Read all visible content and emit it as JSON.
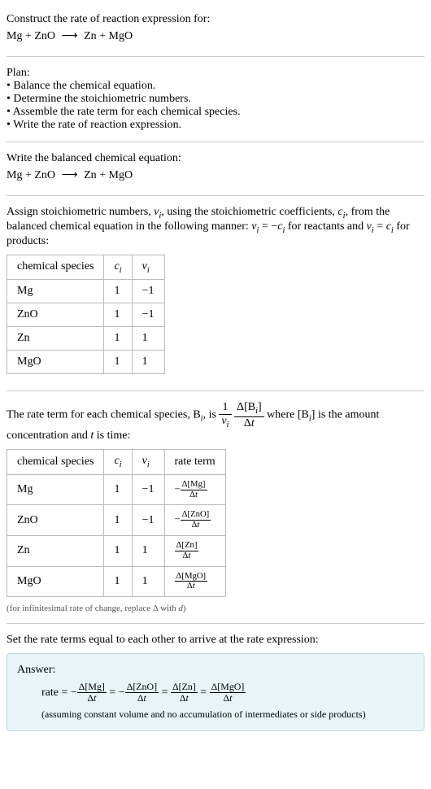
{
  "header": {
    "prompt": "Construct the rate of reaction expression for:",
    "equation_lhs": "Mg + ZnO",
    "equation_arrow": "⟶",
    "equation_rhs": "Zn + MgO"
  },
  "plan": {
    "title": "Plan:",
    "items": [
      "• Balance the chemical equation.",
      "• Determine the stoichiometric numbers.",
      "• Assemble the rate term for each chemical species.",
      "• Write the rate of reaction expression."
    ]
  },
  "balanced": {
    "title": "Write the balanced chemical equation:",
    "equation_lhs": "Mg + ZnO",
    "equation_arrow": "⟶",
    "equation_rhs": "Zn + MgO"
  },
  "stoich": {
    "intro_1": "Assign stoichiometric numbers, ",
    "nu_i": "ν",
    "sub_i": "i",
    "intro_2": ", using the stoichiometric coefficients, ",
    "c_i": "c",
    "intro_3": ", from the balanced chemical equation in the following manner: ",
    "rel_reactants_lhs": "ν",
    "rel_eq": " = −",
    "rel_reactants_rhs": "c",
    "intro_4": " for reactants and ",
    "rel_products_lhs": "ν",
    "rel_eq2": " = ",
    "rel_products_rhs": "c",
    "intro_5": " for products:",
    "headers": {
      "species": "chemical species",
      "c": "c",
      "c_sub": "i",
      "nu": "ν",
      "nu_sub": "i"
    },
    "rows": [
      {
        "species": "Mg",
        "c": "1",
        "nu": "−1"
      },
      {
        "species": "ZnO",
        "c": "1",
        "nu": "−1"
      },
      {
        "species": "Zn",
        "c": "1",
        "nu": "1"
      },
      {
        "species": "MgO",
        "c": "1",
        "nu": "1"
      }
    ]
  },
  "rate_term": {
    "intro_1": "The rate term for each chemical species, B",
    "sub_i": "i",
    "intro_2": ", is ",
    "frac1_num": "1",
    "frac1_den_sym": "ν",
    "frac2_num": "Δ[B",
    "frac2_num_close": "]",
    "frac2_den": "Δt",
    "intro_3": " where [B",
    "intro_4": "] is the amount concentration and ",
    "t_var": "t",
    "intro_5": " is time:",
    "headers": {
      "species": "chemical species",
      "c": "c",
      "c_sub": "i",
      "nu": "ν",
      "nu_sub": "i",
      "rate": "rate term"
    },
    "rows": [
      {
        "species": "Mg",
        "c": "1",
        "nu": "−1",
        "sign": "−",
        "conc": "Δ[Mg]",
        "den": "Δt"
      },
      {
        "species": "ZnO",
        "c": "1",
        "nu": "−1",
        "sign": "−",
        "conc": "Δ[ZnO]",
        "den": "Δt"
      },
      {
        "species": "Zn",
        "c": "1",
        "nu": "1",
        "sign": "",
        "conc": "Δ[Zn]",
        "den": "Δt"
      },
      {
        "species": "MgO",
        "c": "1",
        "nu": "1",
        "sign": "",
        "conc": "Δ[MgO]",
        "den": "Δt"
      }
    ],
    "footnote": "(for infinitesimal rate of change, replace Δ with d)"
  },
  "final": {
    "title": "Set the rate terms equal to each other to arrive at the rate expression:"
  },
  "answer": {
    "label": "Answer:",
    "rate_word": "rate = ",
    "neg": "−",
    "terms": [
      {
        "num": "Δ[Mg]",
        "den": "Δt"
      },
      {
        "num": "Δ[ZnO]",
        "den": "Δt"
      },
      {
        "num": "Δ[Zn]",
        "den": "Δt"
      },
      {
        "num": "Δ[MgO]",
        "den": "Δt"
      }
    ],
    "eq_sign": " = ",
    "note": "(assuming constant volume and no accumulation of intermediates or side products)"
  }
}
